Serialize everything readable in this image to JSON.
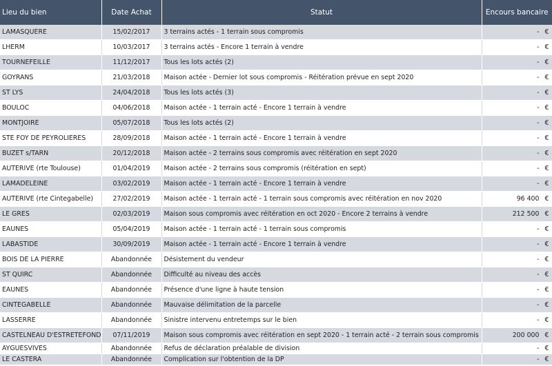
{
  "headers": {
    "lieu": "Lieu du bien",
    "date": "Date Achat",
    "statut": "Statut",
    "encours": "Encours bancaire"
  },
  "rows": [
    {
      "lieu": "LAMASQUERE",
      "date": "15/02/2017",
      "statut": "3 terrains actés - 1 terrain sous compromis",
      "encours": "-",
      "currency": "€"
    },
    {
      "lieu": "LHERM",
      "date": "10/03/2017",
      "statut": "3 terrains actés - Encore 1 terrain à vendre",
      "encours": "-",
      "currency": "€"
    },
    {
      "lieu": "TOURNEFEILLE",
      "date": "11/12/2017",
      "statut": "Tous les lots actés (2)",
      "encours": "-",
      "currency": "€"
    },
    {
      "lieu": "GOYRANS",
      "date": "21/03/2018",
      "statut": "Maison actée - Dernier lot sous compromis - Réitération prévue en sept 2020",
      "encours": "-",
      "currency": "€"
    },
    {
      "lieu": "ST LYS",
      "date": "24/04/2018",
      "statut": "Tous les lots actés (3)",
      "encours": "-",
      "currency": "€"
    },
    {
      "lieu": "BOULOC",
      "date": "04/06/2018",
      "statut": "Maison actée - 1 terrain acté - Encore 1 terrain à vendre",
      "encours": "-",
      "currency": "€"
    },
    {
      "lieu": "MONTJOIRE",
      "date": "05/07/2018",
      "statut": "Tous les lots actés (2)",
      "encours": "-",
      "currency": "€"
    },
    {
      "lieu": "STE FOY DE PEYROLIERES",
      "date": "28/09/2018",
      "statut": "Maison actée - 1 terrain acté - Encore 1 terrain à vendre",
      "encours": "-",
      "currency": "€"
    },
    {
      "lieu": "BUZET s/TARN",
      "date": "20/12/2018",
      "statut": "Maison actée - 2 terrains sous compromis avec réitération en sept 2020",
      "encours": "-",
      "currency": "€"
    },
    {
      "lieu": "AUTERIVE (rte Toulouse)",
      "date": "01/04/2019",
      "statut": "Maison actée - 2 terrains sous compromis (réitération en sept)",
      "encours": "-",
      "currency": "€"
    },
    {
      "lieu": "LAMADELEINE",
      "date": "03/02/2019",
      "statut": "Maison actée - 1 terrain acté - Encore 1 terrain à vendre",
      "encours": "-",
      "currency": "€"
    },
    {
      "lieu": "AUTERIVE (rte Cintegabelle)",
      "date": "27/02/2019",
      "statut": "Maison actée - 1 terrain acté - 1 terrain sous compromis avec réitération en nov 2020",
      "encours": "96 400",
      "currency": "€"
    },
    {
      "lieu": "LE GRES",
      "date": "02/03/2019",
      "statut": "Maison sous compromis avec réitération en oct 2020 - Encore 2 terrains à vendre",
      "encours": "212 500",
      "currency": "€"
    },
    {
      "lieu": "EAUNES",
      "date": "05/04/2019",
      "statut": "Maison actée - 1 terrain acté - 1 terrain sous compromis",
      "encours": "-",
      "currency": "€"
    },
    {
      "lieu": "LABASTIDE",
      "date": "30/09/2019",
      "statut": "Maison actée - 1 terrain acté - Encore 1 terrain à vendre",
      "encours": "-",
      "currency": "€"
    },
    {
      "lieu": "BOIS DE LA PIERRE",
      "date": "Abandonnée",
      "statut": "Désistement du vendeur",
      "encours": "-",
      "currency": "€"
    },
    {
      "lieu": "ST QUIRC",
      "date": "Abandonnée",
      "statut": "Difficulté au niveau des accès",
      "encours": "-",
      "currency": "€"
    },
    {
      "lieu": "EAUNES",
      "date": "Abandonnée",
      "statut": "Présence d'une ligne à haute tension",
      "encours": "-",
      "currency": "€"
    },
    {
      "lieu": "CINTEGABELLE",
      "date": "Abandonnée",
      "statut": "Mauvaise délimitation de la parcelle",
      "encours": "-",
      "currency": "€"
    },
    {
      "lieu": "LASSERRE",
      "date": "Abandonnée",
      "statut": "Sinistre intervenu entretemps sur le bien",
      "encours": "-",
      "currency": "€"
    },
    {
      "lieu": "CASTELNEAU D'ESTRETEFONDS",
      "date": "07/11/2019",
      "statut": "Maison sous compromis avec réitération en sept 2020 - 1 terrain acté - 2 terrain sous compromis",
      "encours": "200 000",
      "currency": "€"
    },
    {
      "lieu": "AYGUESVIVES",
      "date": "Abandonnée",
      "statut": "Refus de déclaration préalable de division",
      "encours": "-",
      "currency": "€"
    },
    {
      "lieu": "LE CASTERA",
      "date": "Abandonnée",
      "statut": "Complication sur l'obtention de la DP",
      "encours": "-",
      "currency": "€"
    }
  ]
}
